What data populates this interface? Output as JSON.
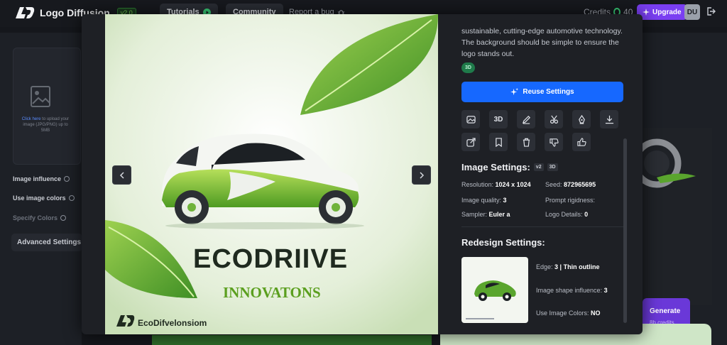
{
  "app": {
    "name": "Logo Diffusion",
    "version": "v2.0"
  },
  "nav": {
    "tutorials": "Tutorials",
    "community": "Community",
    "report": "Report a bug"
  },
  "account": {
    "credits_label": "Credits",
    "credits_value": "40",
    "upgrade": "Upgrade",
    "initials": "DU"
  },
  "left_panel": {
    "upload_link": "Click here",
    "upload_text": " to upload your image (JPG/PNG) up to 5MB",
    "image_influence": "Image influence",
    "use_image_colors": "Use image colors",
    "specify_colors": "Specify Colors",
    "advanced_settings": "Advanced Settings"
  },
  "generate": {
    "label": "Generate",
    "sub": "8h credits"
  },
  "detail": {
    "prompt_tail": "sustainable, cutting-edge automotive technology. The background should be simple to ensure the logo stands out.",
    "style_tag": "3D",
    "reuse_button": "Reuse Settings",
    "tool_3d_label": "3D",
    "image_settings": {
      "title": "Image Settings:",
      "badge_version": "v2",
      "badge_style": "3D",
      "resolution_label": "Resolution:",
      "resolution_value": "1024 x 1024",
      "seed_label": "Seed:",
      "seed_value": "872965695",
      "quality_label": "Image quality:",
      "quality_value": "3",
      "rigidness_label": "Prompt rigidness:",
      "rigidness_value": "",
      "sampler_label": "Sampler:",
      "sampler_value": "Euler a",
      "logo_details_label": "Logo Details:",
      "logo_details_value": "0"
    },
    "redesign_settings": {
      "title": "Redesign Settings:",
      "edge_label": "Edge:",
      "edge_value": "3 | Thin outline",
      "shape_label": "Image shape influence:",
      "shape_value": "3",
      "colors_label": "Use Image Colors:",
      "colors_value": "NO"
    }
  },
  "artwork": {
    "brand": "ECODRIIVE",
    "tagline": "INNOVATONS",
    "watermark": "EcoDifvelonsiom"
  },
  "colors": {
    "accent_blue": "#1668ff",
    "upgrade_purple": "#7a3ff2",
    "leaf_green": "#6fb33a",
    "tag_green": "#1f7a4a"
  }
}
